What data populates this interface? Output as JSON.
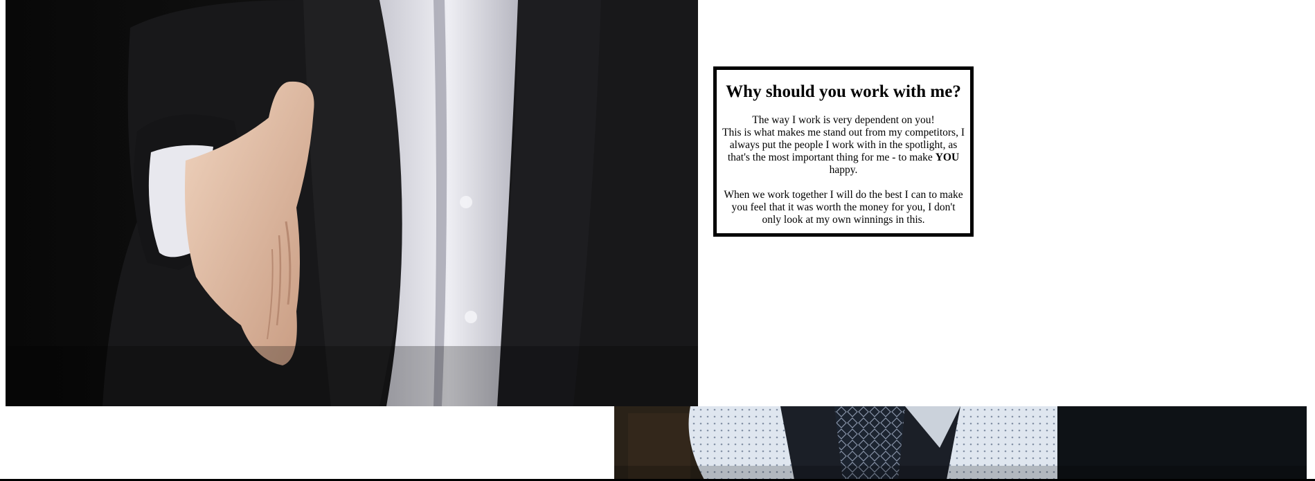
{
  "hero_image": {
    "subject": "businessman-offering-handshake",
    "colors": {
      "background": "#0e0e0e",
      "suit": "#1a1a1c",
      "shirt": "#e6e6ec",
      "skin": "#e2c0a6"
    }
  },
  "info_box": {
    "title": "Why should you work with me?",
    "paragraph1_line1": "The way I work is very dependent on you!",
    "paragraph1_line2_before": "This is what makes me stand out from my competitors, I always put the people I work with in the spotlight, as that's the most important thing for me - to make ",
    "paragraph1_emphasis": "YOU",
    "paragraph1_line2_after": " happy.",
    "paragraph2": "When we work together I will do the best I can to make you feel that it was worth the money for you, I don't only look at my own winnings in this.",
    "border_color": "#000000"
  },
  "bottom_image": {
    "subject": "man-in-patterned-shirt-and-tie",
    "colors": {
      "background": "#101418",
      "shirt": "#dfe6ef",
      "tie": "#1c2430"
    }
  }
}
